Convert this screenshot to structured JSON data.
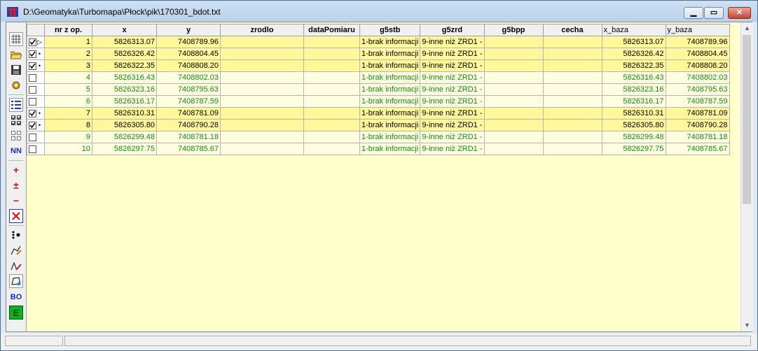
{
  "window": {
    "title": "D:\\Geomatyka\\Turbomapa\\Płock\\pik\\170301_bdot.txt"
  },
  "colors": {
    "selected_row": "#fff79a",
    "normal_row_text": "#1a8a1a",
    "grid_bg": "#ffffcc"
  },
  "toolbar": {
    "nn_label": "NN",
    "bo_label": "BO",
    "e_label": "E",
    "plus_label": "+",
    "plusminus_label": "±",
    "minus_label": "−",
    "icons": [
      "grid-icon",
      "open-folder-icon",
      "save-icon",
      "settings-icon",
      "list-icon",
      "select-all-icon",
      "deselect-all-icon",
      "nn-icon",
      "add-icon",
      "add-remove-icon",
      "remove-icon",
      "delete-icon",
      "points-icon",
      "edit-line-icon",
      "edit-line2-icon",
      "transform-icon",
      "bo-icon",
      "export-icon"
    ]
  },
  "table": {
    "columns": [
      "nr z op.",
      "x",
      "y",
      "zrodlo",
      "dataPomiaru",
      "g5stb",
      "g5zrd",
      "g5bpp",
      "cecha",
      "x_baza",
      "y_baza"
    ],
    "rows": [
      {
        "checked": true,
        "mark": "▷",
        "sel": true,
        "nr": "1",
        "x": "5826313.07",
        "y": "7408789.96",
        "zrodlo": "",
        "dataPomiaru": "",
        "g5stb": "1-brak informacji",
        "g5zrd": "9-inne niż ZRD1 -",
        "g5bpp": "",
        "cecha": "",
        "x_baza": "5826313.07",
        "y_baza": "7408789.96"
      },
      {
        "checked": true,
        "mark": "•",
        "sel": true,
        "nr": "2",
        "x": "5826326.42",
        "y": "7408804.45",
        "zrodlo": "",
        "dataPomiaru": "",
        "g5stb": "1-brak informacji",
        "g5zrd": "9-inne niż ZRD1 -",
        "g5bpp": "",
        "cecha": "",
        "x_baza": "5826326.42",
        "y_baza": "7408804.45"
      },
      {
        "checked": true,
        "mark": "•",
        "sel": true,
        "nr": "3",
        "x": "5826322.35",
        "y": "7408808.20",
        "zrodlo": "",
        "dataPomiaru": "",
        "g5stb": "1-brak informacji",
        "g5zrd": "9-inne niż ZRD1 -",
        "g5bpp": "",
        "cecha": "",
        "x_baza": "5826322.35",
        "y_baza": "7408808.20"
      },
      {
        "checked": false,
        "mark": "",
        "sel": false,
        "nr": "4",
        "x": "5826316.43",
        "y": "7408802.03",
        "zrodlo": "",
        "dataPomiaru": "",
        "g5stb": "1-brak informacji",
        "g5zrd": "9-inne niż ZRD1 -",
        "g5bpp": "",
        "cecha": "",
        "x_baza": "5826316.43",
        "y_baza": "7408802.03"
      },
      {
        "checked": false,
        "mark": "",
        "sel": false,
        "nr": "5",
        "x": "5826323.16",
        "y": "7408795.63",
        "zrodlo": "",
        "dataPomiaru": "",
        "g5stb": "1-brak informacji",
        "g5zrd": "9-inne niż ZRD1 -",
        "g5bpp": "",
        "cecha": "",
        "x_baza": "5826323.16",
        "y_baza": "7408795.63"
      },
      {
        "checked": false,
        "mark": "",
        "sel": false,
        "nr": "6",
        "x": "5826316.17",
        "y": "7408787.59",
        "zrodlo": "",
        "dataPomiaru": "",
        "g5stb": "1-brak informacji",
        "g5zrd": "9-inne niż ZRD1 -",
        "g5bpp": "",
        "cecha": "",
        "x_baza": "5826316.17",
        "y_baza": "7408787.59"
      },
      {
        "checked": true,
        "mark": "•",
        "sel": true,
        "nr": "7",
        "x": "5826310.31",
        "y": "7408781.09",
        "zrodlo": "",
        "dataPomiaru": "",
        "g5stb": "1-brak informacji",
        "g5zrd": "9-inne niż ZRD1 -",
        "g5bpp": "",
        "cecha": "",
        "x_baza": "5826310.31",
        "y_baza": "7408781.09"
      },
      {
        "checked": true,
        "mark": "•",
        "sel": true,
        "nr": "8",
        "x": "5826305.80",
        "y": "7408790.28",
        "zrodlo": "",
        "dataPomiaru": "",
        "g5stb": "1-brak informacji",
        "g5zrd": "9-inne niż ZRD1 -",
        "g5bpp": "",
        "cecha": "",
        "x_baza": "5826305.80",
        "y_baza": "7408790.28"
      },
      {
        "checked": false,
        "mark": "",
        "sel": false,
        "nr": "9",
        "x": "5826299.48",
        "y": "7408781.18",
        "zrodlo": "",
        "dataPomiaru": "",
        "g5stb": "1-brak informacji",
        "g5zrd": "9-inne niż ZRD1 -",
        "g5bpp": "",
        "cecha": "",
        "x_baza": "5826299.48",
        "y_baza": "7408781.18"
      },
      {
        "checked": false,
        "mark": "",
        "sel": false,
        "nr": "10",
        "x": "5826297.75",
        "y": "7408785.67",
        "zrodlo": "",
        "dataPomiaru": "",
        "g5stb": "1-brak informacji",
        "g5zrd": "9-inne niż ZRD1 -",
        "g5bpp": "",
        "cecha": "",
        "x_baza": "5826297.75",
        "y_baza": "7408785.67"
      }
    ]
  },
  "statusbar": {
    "panel1": "",
    "panel2": ""
  }
}
